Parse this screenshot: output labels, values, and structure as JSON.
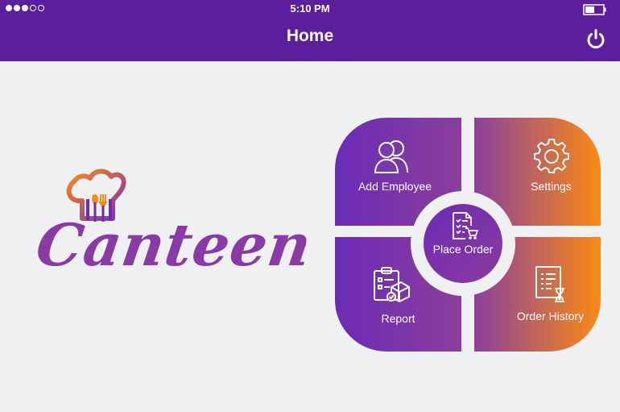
{
  "status_bar": {
    "time": "5:10 PM",
    "signal_dots_filled": 3,
    "signal_dots_total": 5,
    "battery_icon": "battery-icon"
  },
  "header": {
    "title": "Home",
    "power_icon": "power-icon"
  },
  "logo": {
    "text": "Canteen",
    "icon": "chef-hat-cutlery-icon"
  },
  "menu": {
    "add_employee": {
      "label": "Add Employee",
      "icon": "users-icon"
    },
    "settings": {
      "label": "Settings",
      "icon": "gear-icon"
    },
    "place_order": {
      "label": "Place Order",
      "icon": "order-cart-icon"
    },
    "report": {
      "label": "Report",
      "icon": "clipboard-report-icon"
    },
    "order_history": {
      "label": "Order History",
      "icon": "document-hourglass-icon"
    }
  },
  "colors": {
    "header_bg": "#5a1f9c",
    "purple": "#6a2bb8",
    "orange": "#fb8a14",
    "background": "#eef0f2"
  }
}
